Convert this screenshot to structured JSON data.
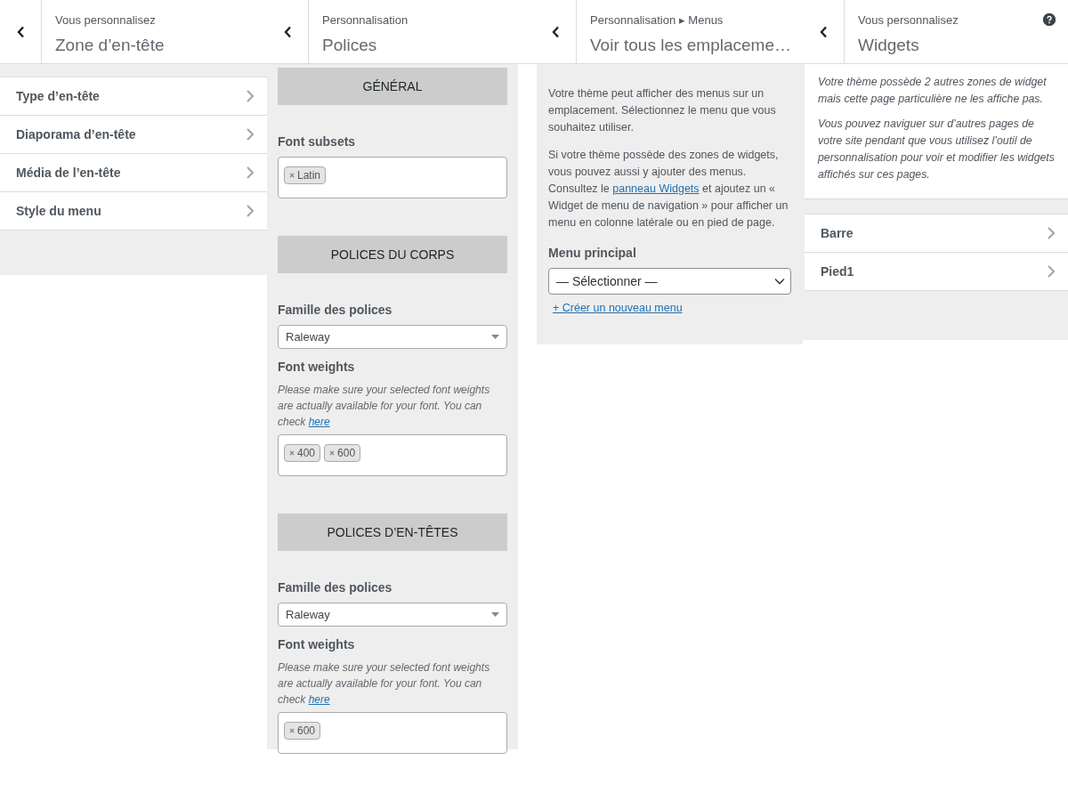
{
  "panels": [
    {
      "kind": "sections",
      "breadcrumb": "Vous personnalisez",
      "title": "Zone d’en-tête",
      "items": [
        "Type d’en-tête",
        "Diaporama d’en-tête",
        "Média de l’en-tête",
        "Style du menu"
      ]
    },
    {
      "kind": "fonts",
      "breadcrumb": "Personnalisation",
      "title": "Polices",
      "groups": [
        {
          "heading": "GÉNÉRAL",
          "fields": [
            {
              "kind": "tags",
              "label": "Font subsets",
              "tags": [
                "Latin"
              ]
            }
          ]
        },
        {
          "heading": "POLICES DU CORPS",
          "fields": [
            {
              "kind": "select",
              "label": "Famille des polices",
              "value": "Raleway"
            },
            {
              "kind": "tags",
              "label": "Font weights",
              "hint": {
                "text": "Please make sure your selected font weights are actually available for your font. You can check ",
                "link": "here"
              },
              "tags": [
                "400",
                "600"
              ]
            }
          ]
        },
        {
          "heading": "POLICES D’EN-TÊTES",
          "fields": [
            {
              "kind": "select",
              "label": "Famille des polices",
              "value": "Raleway"
            },
            {
              "kind": "tags",
              "label": "Font weights",
              "hint": {
                "text": "Please make sure your selected font weights are actually available for your font. You can check ",
                "link": "here"
              },
              "tags": [
                "600"
              ]
            }
          ]
        }
      ]
    },
    {
      "kind": "menus",
      "breadcrumb": "Personnalisation ▸ Menus",
      "title": "Voir tous les emplaceme…",
      "paragraphs": [
        {
          "text": "Votre thème peut afficher des menus sur un emplacement. Sélectionnez le menu que vous souhaitez utiliser."
        },
        {
          "text": "Si votre thème possède des zones de widgets, vous pouvez aussi y ajouter des menus. Consultez le ",
          "link": "panneau Widgets",
          "after": " et ajoutez un « Widget de menu de navigation » pour afficher un menu en colonne latérale ou en pied de page."
        }
      ],
      "select_label": "Menu principal",
      "select_value": "— Sélectionner —",
      "create_link": "+ Créer un nouveau menu"
    },
    {
      "kind": "widgets",
      "breadcrumb": "Vous personnalisez",
      "title": "Widgets",
      "help_button": true,
      "notes": [
        "Votre thème possède 2 autres zones de widget mais cette page particulière ne les affiche pas.",
        "Vous pouvez naviguer sur d’autres pages de votre site pendant que vous utilisez l’outil de personnalisation pour voir et modifier les widgets affichés sur ces pages."
      ],
      "items": [
        "Barre",
        "Pied1"
      ]
    }
  ]
}
